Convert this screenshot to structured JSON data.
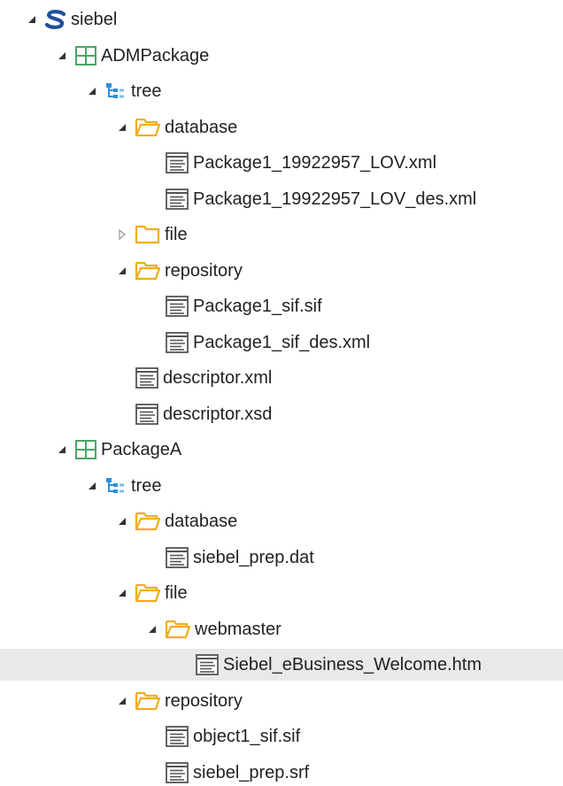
{
  "tree": {
    "rows": [
      {
        "label": "siebel",
        "icon": "siebel-logo-icon",
        "state": "expanded",
        "level": 0
      },
      {
        "label": "ADMPackage",
        "icon": "package-grid-icon",
        "state": "expanded",
        "level": 1
      },
      {
        "label": "tree",
        "icon": "tree-structure-icon",
        "state": "expanded",
        "level": 2
      },
      {
        "label": "database",
        "icon": "folder-open-icon",
        "state": "expanded",
        "level": 3
      },
      {
        "label": "Package1_19922957_LOV.xml",
        "icon": "file-icon",
        "state": "leaf",
        "level": 4
      },
      {
        "label": "Package1_19922957_LOV_des.xml",
        "icon": "file-icon",
        "state": "leaf",
        "level": 4
      },
      {
        "label": "file",
        "icon": "folder-closed-icon",
        "state": "collapsed",
        "level": 3
      },
      {
        "label": "repository",
        "icon": "folder-open-icon",
        "state": "expanded",
        "level": 3
      },
      {
        "label": "Package1_sif.sif",
        "icon": "file-icon",
        "state": "leaf",
        "level": 4
      },
      {
        "label": "Package1_sif_des.xml",
        "icon": "file-icon",
        "state": "leaf",
        "level": 4
      },
      {
        "label": "descriptor.xml",
        "icon": "file-icon",
        "state": "leaf",
        "level": 3
      },
      {
        "label": "descriptor.xsd",
        "icon": "file-icon",
        "state": "leaf",
        "level": 3
      },
      {
        "label": "PackageA",
        "icon": "package-grid-icon",
        "state": "expanded",
        "level": 1
      },
      {
        "label": "tree",
        "icon": "tree-structure-icon",
        "state": "expanded",
        "level": 2
      },
      {
        "label": "database",
        "icon": "folder-open-icon",
        "state": "expanded",
        "level": 3
      },
      {
        "label": "siebel_prep.dat",
        "icon": "file-icon",
        "state": "leaf",
        "level": 4
      },
      {
        "label": "file",
        "icon": "folder-open-icon",
        "state": "expanded",
        "level": 3
      },
      {
        "label": "webmaster",
        "icon": "folder-open-icon",
        "state": "expanded",
        "level": 4
      },
      {
        "label": "Siebel_eBusiness_Welcome.htm",
        "icon": "file-icon",
        "state": "leaf",
        "level": 5,
        "selected": true
      },
      {
        "label": "repository",
        "icon": "folder-open-icon",
        "state": "expanded",
        "level": 3
      },
      {
        "label": "object1_sif.sif",
        "icon": "file-icon",
        "state": "leaf",
        "level": 4
      },
      {
        "label": "siebel_prep.srf",
        "icon": "file-icon",
        "state": "leaf",
        "level": 4
      }
    ]
  },
  "colors": {
    "siebel_blue": "#1f4f9a",
    "package_green": "#4aa564",
    "tree_blue": "#2f8fd8",
    "folder_orange": "#f0ad1c",
    "file_gray": "#555555",
    "selection_bg": "#e9e9e9"
  }
}
